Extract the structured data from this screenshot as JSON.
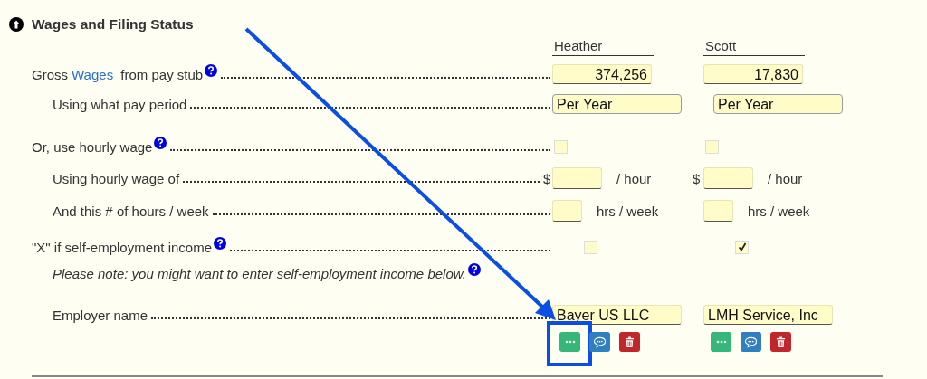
{
  "section": {
    "title": "Wages and Filing Status",
    "expanded": true
  },
  "people": [
    {
      "name": "Heather"
    },
    {
      "name": "Scott"
    }
  ],
  "rows": [
    {
      "kind": "amount",
      "label": "Gross",
      "link": "Wages",
      "label_after": "from pay stub",
      "help": true,
      "cells": [
        {
          "value": "374,256"
        },
        {
          "value": "17,830"
        }
      ],
      "children": [
        {
          "kind": "select",
          "label": "Using what pay period",
          "cells": [
            {
              "value": "Per Year"
            },
            {
              "value": "Per Year"
            }
          ]
        }
      ]
    },
    {
      "kind": "checkbox",
      "label": "Or, use hourly wage",
      "help": true,
      "cells": [
        {
          "checked": false
        },
        {
          "checked": false
        }
      ],
      "children": [
        {
          "kind": "rate",
          "label": "Using hourly wage of",
          "cells": [
            {
              "prefix": "$",
              "unit": "/ hour"
            },
            {
              "prefix": "$",
              "unit": "/ hour"
            }
          ]
        },
        {
          "kind": "hours",
          "label": "And this # of hours / week",
          "cells": [
            {
              "unit": "hrs / week"
            },
            {
              "unit": "hrs / week"
            }
          ]
        }
      ]
    },
    {
      "kind": "mark",
      "label": "\"X\" if self-employment income",
      "help": true,
      "cells": [
        {
          "checked": false
        },
        {
          "checked": true
        }
      ],
      "children": [
        {
          "kind": "note",
          "label": "Please note: you might want to enter self-employment income below.",
          "help": true
        },
        {
          "kind": "text",
          "label": "Employer name",
          "cells": [
            {
              "value": "Bayer US LLC"
            },
            {
              "value": "LMH Service, Inc"
            }
          ]
        }
      ]
    }
  ],
  "actions": [
    [
      {
        "kind": "more",
        "highlighted": true
      },
      {
        "kind": "comment"
      },
      {
        "kind": "delete"
      }
    ],
    [
      {
        "kind": "more"
      },
      {
        "kind": "comment"
      },
      {
        "kind": "delete"
      }
    ]
  ]
}
